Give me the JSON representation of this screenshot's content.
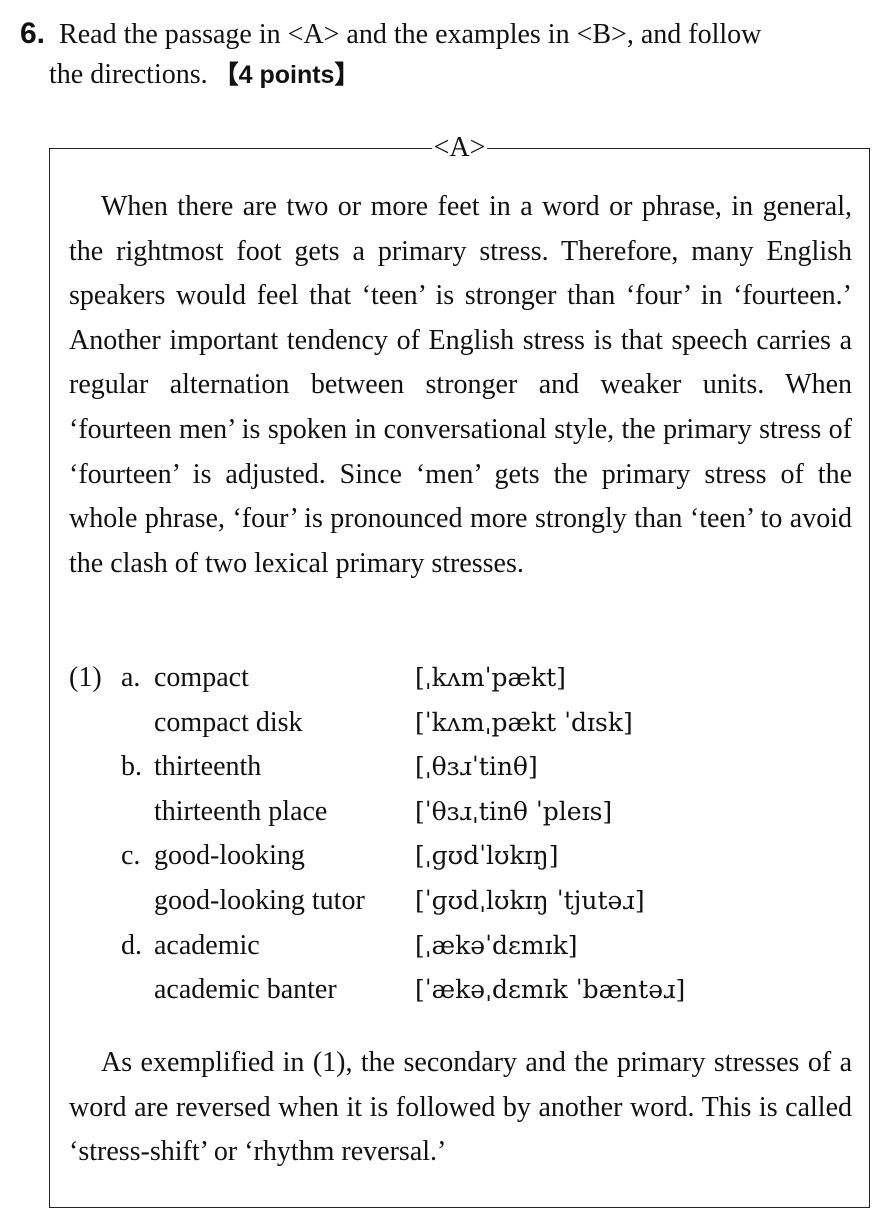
{
  "question": {
    "number": "6.",
    "instruction_line1": "Read the passage in <A> and the examples in <B>, and follow",
    "instruction_line2": "the directions.",
    "points": "【4 points】"
  },
  "passage": {
    "label": "<A>",
    "paragraph1": "When there are two or more feet in a word or phrase, in general, the rightmost foot gets a primary stress. Therefore, many English speakers would feel that ‘teen’ is stronger than ‘four’ in ‘fourteen.’ Another important tendency of English stress is that speech carries a regular alternation between stronger and weaker units. When ‘fourteen men’ is spoken in conversational style, the primary stress of ‘fourteen’ is adjusted. Since ‘men’ gets the primary stress of the whole phrase, ‘four’ is pronounced more strongly than ‘teen’ to avoid the clash of two lexical primary stresses.",
    "example_number": "(1)",
    "examples": [
      {
        "letter": "a.",
        "word": "compact",
        "ipa": "[ˌkʌmˈpækt]"
      },
      {
        "letter": "",
        "word": "compact disk",
        "ipa": "[ˈkʌmˌpækt ˈdɪsk]"
      },
      {
        "letter": "b.",
        "word": "thirteenth",
        "ipa": "[ˌθɜɹˈtinθ]"
      },
      {
        "letter": "",
        "word": "thirteenth place",
        "ipa": "[ˈθɜɹˌtinθ ˈpleɪs]"
      },
      {
        "letter": "c.",
        "word": "good-looking",
        "ipa": "[ˌɡʊdˈlʊkɪŋ]"
      },
      {
        "letter": "",
        "word": "good-looking tutor",
        "ipa": "[ˈɡʊdˌlʊkɪŋ ˈtjutəɹ]"
      },
      {
        "letter": "d.",
        "word": "academic",
        "ipa": "[ˌækəˈdɛmɪk]"
      },
      {
        "letter": "",
        "word": "academic banter",
        "ipa": "[ˈækəˌdɛmɪk ˈbæntəɹ]"
      }
    ],
    "paragraph2": "As exemplified in (1), the secondary and the primary stresses of a word are reversed when it is followed by another word. This is called ‘stress-shift’ or ‘rhythm reversal.’"
  }
}
